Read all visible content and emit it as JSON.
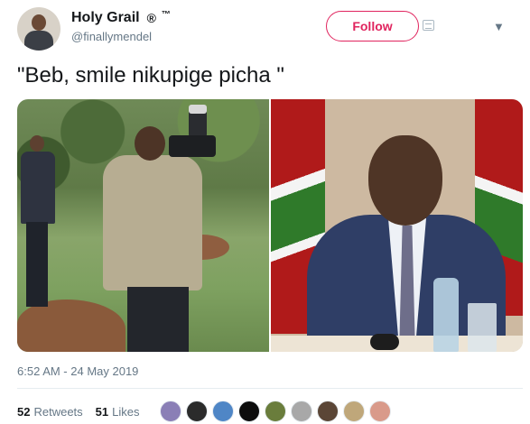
{
  "author": {
    "display_name": "Holy Grail",
    "registered_mark": "®",
    "trademark": "™",
    "handle": "@finallymendel"
  },
  "actions": {
    "follow_label": "Follow",
    "menu_icon": "chevron-down-icon"
  },
  "tweet": {
    "text": "\"Beb, smile nikupige picha \"",
    "timestamp": "6:52 AM - 24 May 2019"
  },
  "stats": {
    "retweets_count": "52",
    "retweets_label": "Retweets",
    "likes_count": "51",
    "likes_label": "Likes"
  },
  "likers": [
    {
      "color": "#8a7fb6"
    },
    {
      "color": "#2b2b2b"
    },
    {
      "color": "#4f86c6"
    },
    {
      "color": "#0d0d0d"
    },
    {
      "color": "#6a7d3c"
    },
    {
      "color": "#a8a8a8"
    },
    {
      "color": "#5b4636"
    },
    {
      "color": "#bfa77a"
    },
    {
      "color": "#d99a8a"
    }
  ],
  "colors": {
    "accent": "#e0245e",
    "secondary_text": "#657786"
  }
}
